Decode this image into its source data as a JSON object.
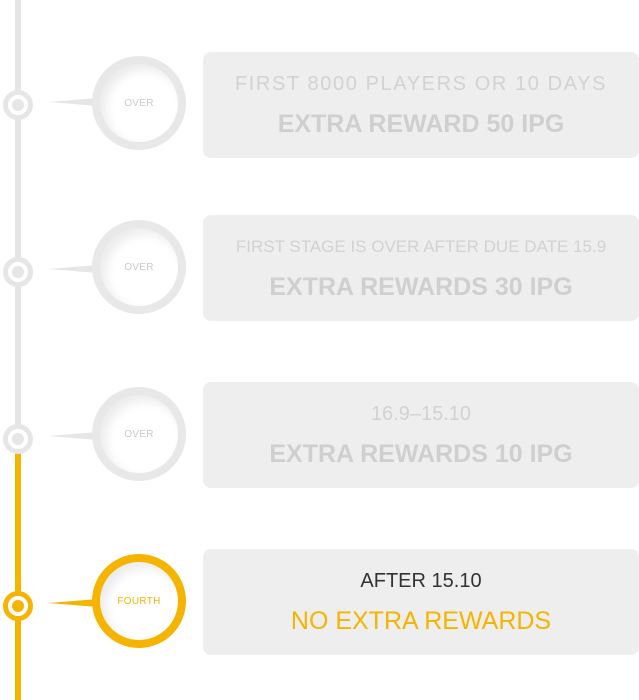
{
  "stages": [
    {
      "status": "OVER",
      "line1": "FIRST 8000 PLAYERS OR 10 DAYS",
      "line2": "EXTRA REWARD 50 IPG"
    },
    {
      "status": "OVER",
      "line1": "FIRST STAGE IS OVER AFTER DUE DATE 15.9",
      "line2": "EXTRA REWARDS 30 IPG"
    },
    {
      "status": "OVER",
      "line1": "16.9–15.10",
      "line2": "EXTRA REWARDS 10 IPG"
    },
    {
      "status": "FOURTH",
      "line1": "AFTER 15.10",
      "line2": "NO EXTRA REWARDS"
    }
  ],
  "colors": {
    "accent": "#f5b400",
    "inactive": "#e6e6e6",
    "card_bg": "#eeeeee"
  }
}
